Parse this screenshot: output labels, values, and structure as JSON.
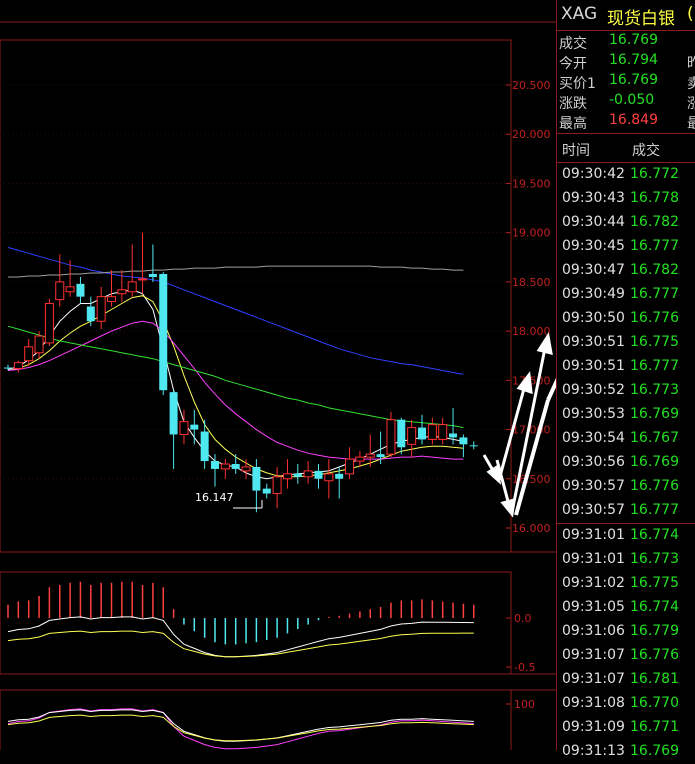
{
  "symbol": {
    "code": "XAG",
    "name": "现货白银",
    "extra": "("
  },
  "quote": [
    {
      "label": "成交",
      "value": "16.769",
      "color": "#22e022",
      "edge": ""
    },
    {
      "label": "今开",
      "value": "16.794",
      "color": "#22e022",
      "edge": "昨"
    },
    {
      "label": "买价1",
      "value": "16.769",
      "color": "#22e022",
      "edge": "卖"
    },
    {
      "label": "涨跌",
      "value": "-0.050",
      "color": "#22e022",
      "edge": "涨"
    },
    {
      "label": "最高",
      "value": "16.849",
      "color": "#ff4040",
      "edge": "最"
    }
  ],
  "ticks_header": {
    "time": "时间",
    "price": "成交"
  },
  "ticks": [
    {
      "time": "09:30:42",
      "price": "16.772"
    },
    {
      "time": "09:30:43",
      "price": "16.778"
    },
    {
      "time": "09:30:44",
      "price": "16.782"
    },
    {
      "time": "09:30:45",
      "price": "16.777"
    },
    {
      "time": "09:30:47",
      "price": "16.782"
    },
    {
      "time": "09:30:49",
      "price": "16.777"
    },
    {
      "time": "09:30:50",
      "price": "16.776"
    },
    {
      "time": "09:30:51",
      "price": "16.775"
    },
    {
      "time": "09:30:51",
      "price": "16.777"
    },
    {
      "time": "09:30:52",
      "price": "16.773"
    },
    {
      "time": "09:30:53",
      "price": "16.769"
    },
    {
      "time": "09:30:54",
      "price": "16.767"
    },
    {
      "time": "09:30:56",
      "price": "16.769"
    },
    {
      "time": "09:30:57",
      "price": "16.776"
    },
    {
      "time": "09:30:57",
      "price": "16.777"
    },
    {
      "time": "09:31:01",
      "price": "16.774"
    },
    {
      "time": "09:31:01",
      "price": "16.773"
    },
    {
      "time": "09:31:02",
      "price": "16.775"
    },
    {
      "time": "09:31:05",
      "price": "16.774"
    },
    {
      "time": "09:31:06",
      "price": "16.779"
    },
    {
      "time": "09:31:07",
      "price": "16.776"
    },
    {
      "time": "09:31:07",
      "price": "16.781"
    },
    {
      "time": "09:31:08",
      "price": "16.770"
    },
    {
      "time": "09:31:09",
      "price": "16.771"
    },
    {
      "time": "09:31:13",
      "price": "16.769"
    }
  ],
  "chart_data": {
    "type": "candlestick",
    "main_axis": {
      "ticks": [
        "20.500",
        "20.000",
        "19.500",
        "19.000",
        "18.500",
        "18.000",
        "17.500",
        "17.000",
        "16.500",
        "16.000"
      ],
      "ylim": [
        15.95,
        20.7
      ]
    },
    "low_annotation": "16.147",
    "macd_axis": {
      "ticks": [
        "0.0",
        "-0.5"
      ]
    },
    "osc_axis": {
      "ticks": [
        "100"
      ]
    },
    "candles": [
      [
        17.63,
        17.62,
        17.66,
        17.6
      ],
      [
        17.62,
        17.68,
        17.7,
        17.58
      ],
      [
        17.7,
        17.84,
        17.92,
        17.65
      ],
      [
        17.78,
        17.95,
        18.0,
        17.72
      ],
      [
        17.88,
        18.28,
        18.33,
        17.85
      ],
      [
        18.32,
        18.5,
        18.78,
        18.25
      ],
      [
        18.4,
        18.45,
        18.72,
        18.35
      ],
      [
        18.48,
        18.35,
        18.55,
        18.28
      ],
      [
        18.25,
        18.1,
        18.35,
        18.05
      ],
      [
        18.1,
        18.35,
        18.45,
        18.02
      ],
      [
        18.3,
        18.35,
        18.62,
        18.25
      ],
      [
        18.38,
        18.42,
        18.62,
        18.3
      ],
      [
        18.4,
        18.5,
        18.88,
        18.35
      ],
      [
        18.52,
        18.53,
        19.0,
        18.38
      ],
      [
        18.58,
        18.55,
        18.88,
        18.5
      ],
      [
        18.58,
        17.4,
        18.6,
        17.35
      ],
      [
        17.38,
        16.95,
        17.4,
        16.6
      ],
      [
        16.95,
        17.08,
        17.2,
        16.85
      ],
      [
        17.05,
        17.0,
        17.2,
        16.85
      ],
      [
        16.98,
        16.68,
        17.1,
        16.6
      ],
      [
        16.68,
        16.6,
        16.75,
        16.42
      ],
      [
        16.6,
        16.65,
        16.7,
        16.5
      ],
      [
        16.65,
        16.6,
        16.75,
        16.55
      ],
      [
        16.58,
        16.62,
        16.7,
        16.5
      ],
      [
        16.62,
        16.38,
        16.7,
        16.16
      ],
      [
        16.4,
        16.35,
        16.45,
        16.3
      ],
      [
        16.35,
        16.52,
        16.62,
        16.2
      ],
      [
        16.5,
        16.55,
        16.7,
        16.4
      ],
      [
        16.55,
        16.52,
        16.65,
        16.45
      ],
      [
        16.52,
        16.58,
        16.68,
        16.45
      ],
      [
        16.58,
        16.5,
        16.65,
        16.4
      ],
      [
        16.48,
        16.55,
        16.7,
        16.3
      ],
      [
        16.55,
        16.5,
        16.62,
        16.3
      ],
      [
        16.55,
        16.7,
        16.82,
        16.5
      ],
      [
        16.68,
        16.72,
        16.78,
        16.62
      ],
      [
        16.72,
        16.75,
        16.95,
        16.62
      ],
      [
        16.75,
        16.72,
        16.98,
        16.65
      ],
      [
        16.75,
        17.1,
        17.18,
        16.72
      ],
      [
        17.1,
        16.82,
        17.12,
        16.75
      ],
      [
        16.85,
        17.02,
        17.1,
        16.72
      ],
      [
        17.02,
        16.9,
        17.15,
        16.85
      ],
      [
        16.9,
        17.05,
        17.12,
        16.85
      ],
      [
        16.9,
        17.05,
        17.12,
        16.85
      ],
      [
        16.96,
        16.92,
        17.22,
        16.85
      ],
      [
        16.92,
        16.85,
        16.95,
        16.72
      ],
      [
        16.84,
        16.83,
        16.88,
        16.8
      ]
    ],
    "histogram": [
      0.12,
      0.15,
      0.16,
      0.2,
      0.28,
      0.3,
      0.32,
      0.33,
      0.3,
      0.32,
      0.32,
      0.33,
      0.33,
      0.3,
      0.32,
      0.28,
      0.08,
      -0.06,
      -0.12,
      -0.18,
      -0.22,
      -0.24,
      -0.24,
      -0.23,
      -0.22,
      -0.2,
      -0.18,
      -0.14,
      -0.1,
      -0.06,
      -0.02,
      0.01,
      0.02,
      0.04,
      0.06,
      0.08,
      0.1,
      0.14,
      0.16,
      0.16,
      0.17,
      0.16,
      0.15,
      0.14,
      0.13,
      0.12
    ],
    "series": [
      {
        "color": "#ffffff",
        "y": [
          17.61,
          17.64,
          17.71,
          17.8,
          17.95,
          18.1,
          18.2,
          18.28,
          18.28,
          18.33,
          18.38,
          18.4,
          18.42,
          18.38,
          18.22,
          17.82,
          17.4,
          17.08,
          16.92,
          16.78,
          16.68,
          16.64,
          16.62,
          16.56,
          16.52,
          16.5,
          16.52,
          16.54,
          16.55,
          16.56,
          16.57,
          16.58,
          16.62,
          16.66,
          16.7,
          16.75,
          16.8,
          16.85,
          16.88,
          16.9,
          16.92,
          16.93,
          16.92,
          16.9,
          16.88
        ]
      },
      {
        "color": "#ffff55",
        "y": [
          17.6,
          17.62,
          17.66,
          17.72,
          17.8,
          17.9,
          17.98,
          18.05,
          18.1,
          18.16,
          18.22,
          18.28,
          18.34,
          18.36,
          18.3,
          18.1,
          17.85,
          17.55,
          17.28,
          17.05,
          16.9,
          16.8,
          16.72,
          16.66,
          16.6,
          16.56,
          16.53,
          16.52,
          16.52,
          16.53,
          16.54,
          16.56,
          16.58,
          16.6,
          16.63,
          16.66,
          16.7,
          16.74,
          16.78,
          16.8,
          16.82,
          16.83,
          16.83,
          16.82,
          16.81
        ]
      },
      {
        "color": "#ff40ff",
        "y": [
          17.6,
          17.61,
          17.63,
          17.66,
          17.7,
          17.75,
          17.8,
          17.85,
          17.9,
          17.95,
          18.0,
          18.04,
          18.08,
          18.1,
          18.08,
          18.0,
          17.88,
          17.75,
          17.62,
          17.48,
          17.36,
          17.25,
          17.16,
          17.08,
          17.0,
          16.93,
          16.87,
          16.83,
          16.79,
          16.76,
          16.74,
          16.72,
          16.71,
          16.7,
          16.7,
          16.7,
          16.7,
          16.71,
          16.72,
          16.72,
          16.73,
          16.72,
          16.71,
          16.7,
          16.7
        ]
      },
      {
        "color": "#30e030",
        "y": [
          18.05,
          18.02,
          17.99,
          17.96,
          17.93,
          17.9,
          17.88,
          17.86,
          17.84,
          17.82,
          17.8,
          17.78,
          17.76,
          17.74,
          17.72,
          17.69,
          17.66,
          17.63,
          17.6,
          17.57,
          17.54,
          17.5,
          17.47,
          17.44,
          17.41,
          17.38,
          17.35,
          17.32,
          17.3,
          17.27,
          17.25,
          17.22,
          17.2,
          17.18,
          17.16,
          17.14,
          17.12,
          17.1,
          17.09,
          17.08,
          17.07,
          17.06,
          17.05,
          17.04,
          17.02
        ]
      },
      {
        "color": "#3040ff",
        "y": [
          18.85,
          18.82,
          18.79,
          18.76,
          18.73,
          18.7,
          18.67,
          18.65,
          18.62,
          18.6,
          18.58,
          18.56,
          18.55,
          18.54,
          18.52,
          18.5,
          18.46,
          18.42,
          18.38,
          18.34,
          18.3,
          18.26,
          18.22,
          18.18,
          18.14,
          18.1,
          18.06,
          18.02,
          17.98,
          17.94,
          17.9,
          17.86,
          17.82,
          17.79,
          17.76,
          17.73,
          17.71,
          17.69,
          17.67,
          17.66,
          17.64,
          17.62,
          17.6,
          17.58,
          17.56
        ]
      },
      {
        "color": "#a0a0a0",
        "y": [
          18.55,
          18.55,
          18.56,
          18.56,
          18.57,
          18.57,
          18.58,
          18.58,
          18.59,
          18.59,
          18.6,
          18.6,
          18.61,
          18.61,
          18.62,
          18.62,
          18.63,
          18.63,
          18.64,
          18.64,
          18.64,
          18.65,
          18.65,
          18.65,
          18.65,
          18.66,
          18.66,
          18.66,
          18.66,
          18.66,
          18.66,
          18.66,
          18.66,
          18.66,
          18.66,
          18.66,
          18.65,
          18.65,
          18.65,
          18.64,
          18.64,
          18.63,
          18.63,
          18.62,
          18.62
        ]
      }
    ]
  }
}
